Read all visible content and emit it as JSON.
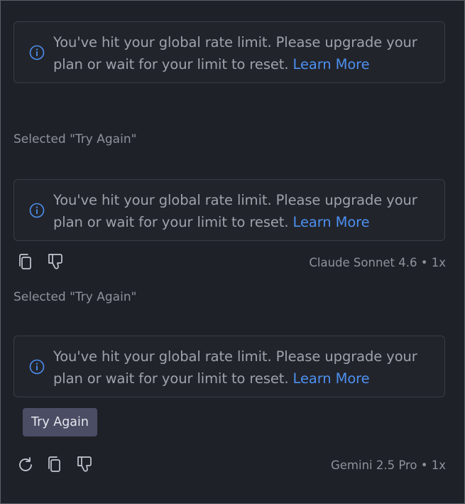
{
  "messages": [
    {
      "alert": {
        "text": "You've hit your global rate limit. Please upgrade your plan or wait for your limit to reset.",
        "link": "Learn More"
      }
    },
    {
      "selected": "Selected \"Try Again\"",
      "alert": {
        "text": "You've hit your global rate limit. Please upgrade your plan or wait for your limit to reset.",
        "link": "Learn More"
      },
      "meta": "Claude Sonnet 4.6 • 1x"
    },
    {
      "selected": "Selected \"Try Again\"",
      "alert": {
        "text": "You've hit your global rate limit. Please upgrade your plan or wait for your limit to reset.",
        "link": "Learn More"
      },
      "try_again_label": "Try Again",
      "meta": "Gemini 2.5 Pro • 1x"
    }
  ],
  "icons": {
    "info": "info-circle-icon",
    "copy": "copy-icon",
    "dislike": "thumbs-down-icon",
    "retry": "retry-icon"
  },
  "colors": {
    "background": "#1f2128",
    "alert_border": "#3a3d46",
    "link": "#4d90f0",
    "info_icon": "#4d90f0",
    "text": "#9ea2ab",
    "button_bg": "#4a4d64"
  }
}
